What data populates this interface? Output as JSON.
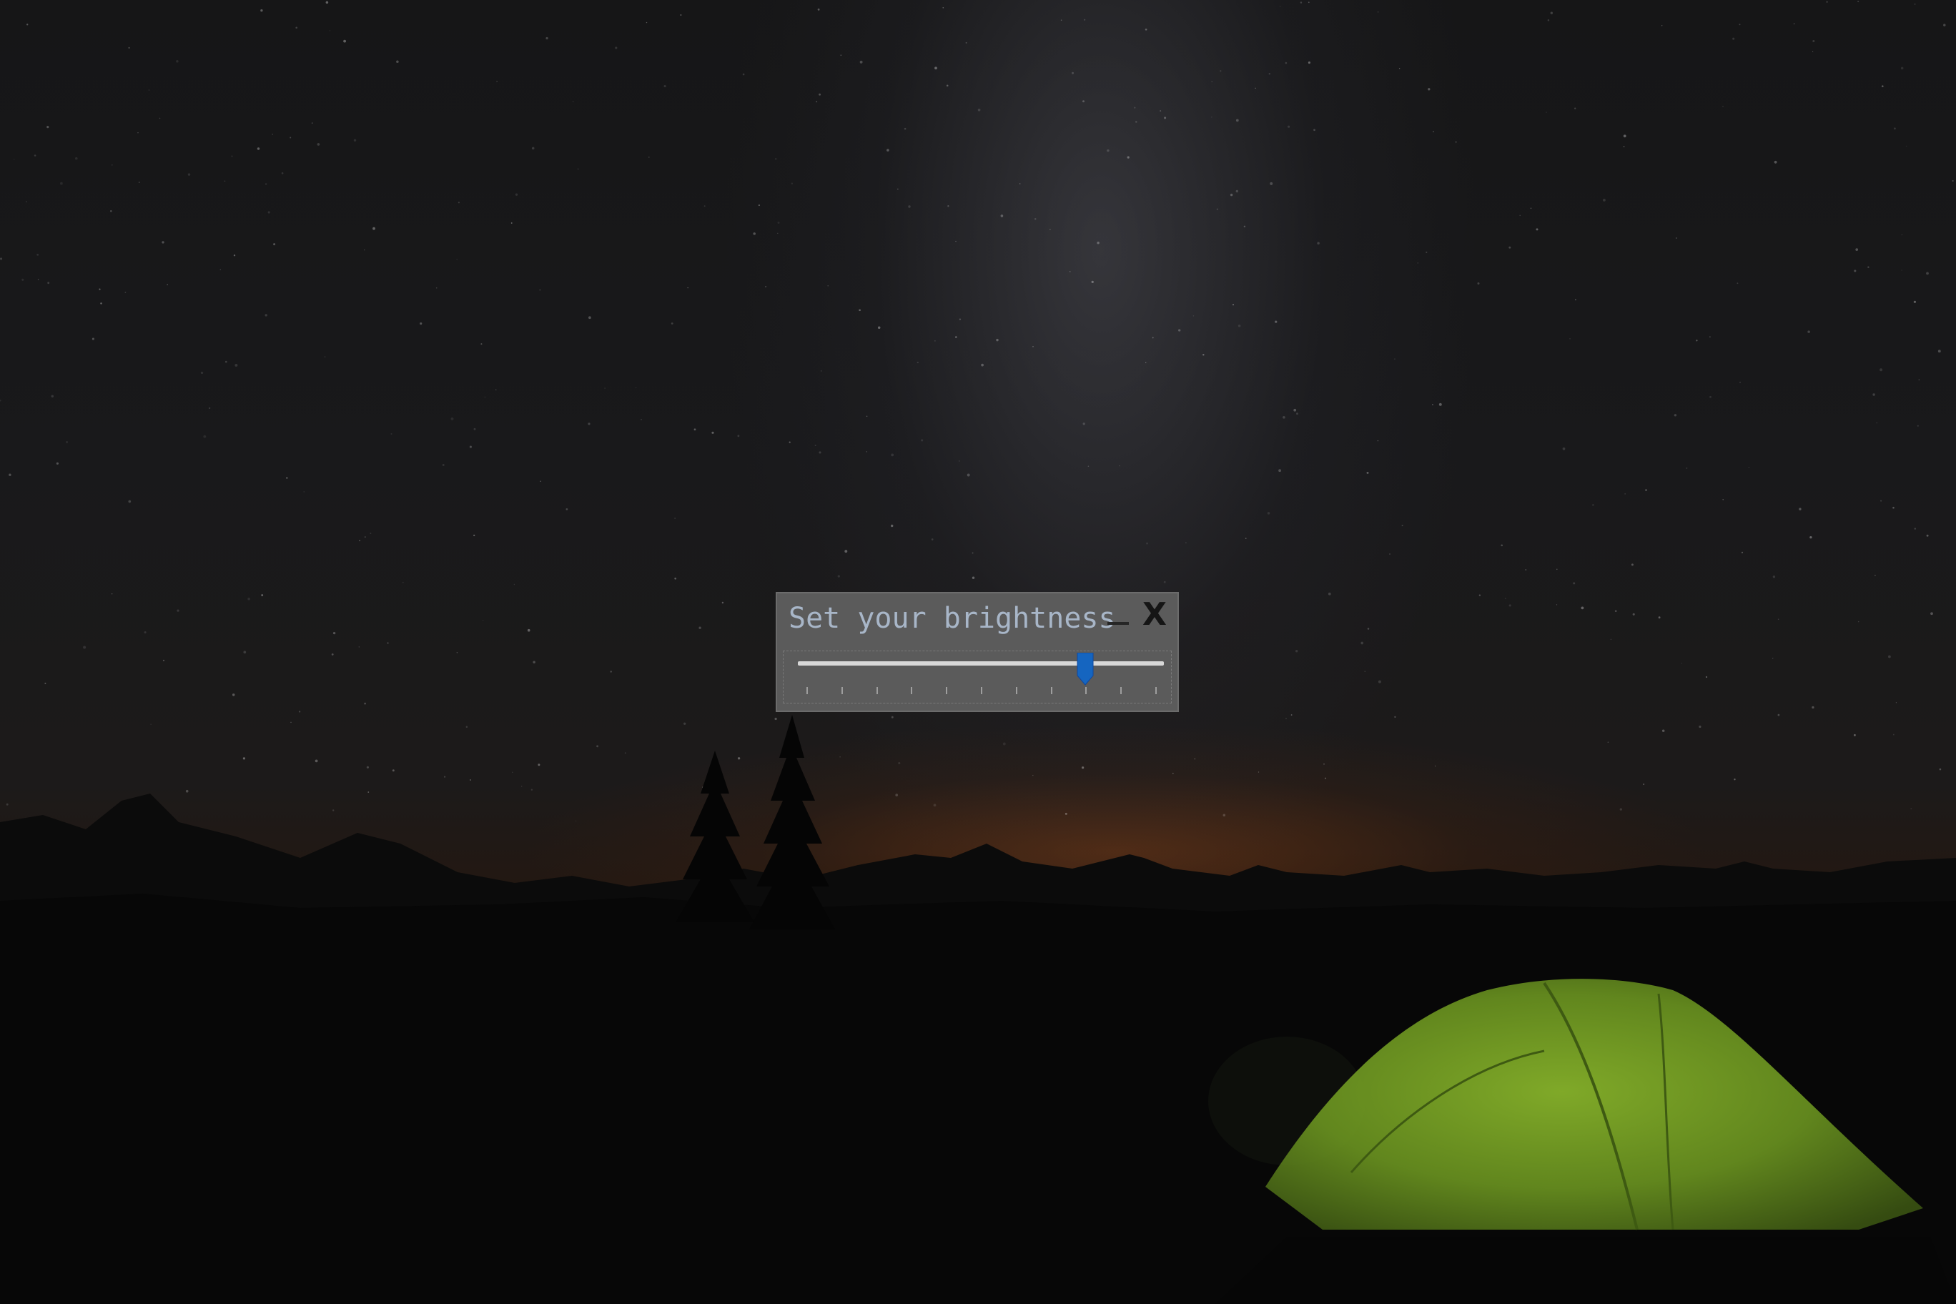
{
  "dialog": {
    "title": "Set your brightness",
    "minimize_icon": "minimize-icon",
    "close_label": "X"
  },
  "brightness_slider": {
    "value_fraction": 0.785,
    "tick_count": 11,
    "thumb_color": "#1565c0",
    "track_color": "#d8d8d8"
  },
  "wallpaper": {
    "description_icon": "night-sky-camping-wallpaper"
  },
  "colors": {
    "dialog_background": "#5b5b5b",
    "title_text": "#a8b6c8",
    "tent_green": "#6f9a22"
  }
}
